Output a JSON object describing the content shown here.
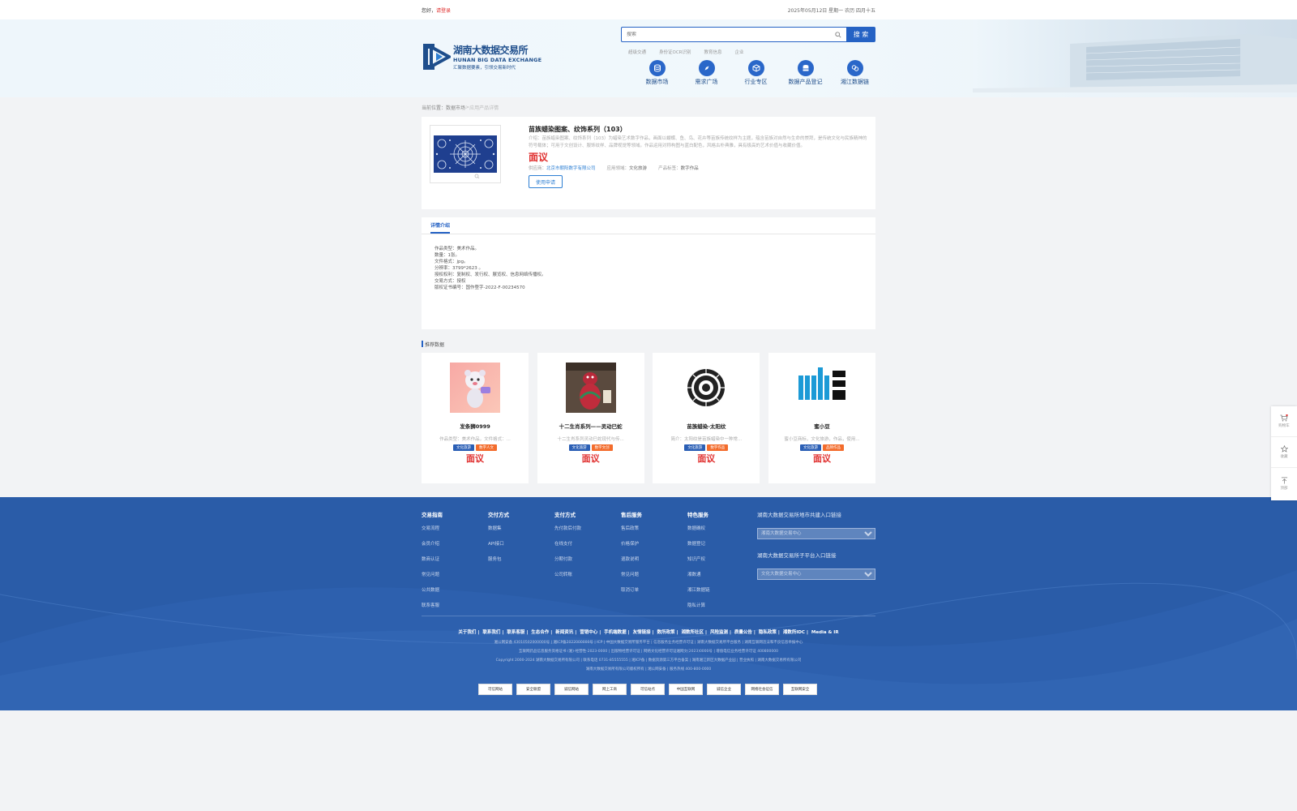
{
  "topbar": {
    "greeting": "您好，",
    "login": "请登录",
    "date": "2025年05月12日 星期一 农历 四月十五"
  },
  "header": {
    "logo_cn": "湖南大数据交易所",
    "logo_en": "HUNAN BIG DATA EXCHANGE",
    "logo_slogan": "汇聚数据要素，引领交易新时代",
    "search_placeholder": "搜索",
    "search_button": "搜 索",
    "hot_keywords": [
      "超级交通",
      "身份证OCR识别",
      "教育信息",
      "企业"
    ],
    "nav": [
      {
        "label": "数据市场",
        "icon": "database-icon"
      },
      {
        "label": "需求广场",
        "icon": "compass-icon"
      },
      {
        "label": "行业专区",
        "icon": "cube-icon"
      },
      {
        "label": "数据产品登记",
        "icon": "register-icon"
      },
      {
        "label": "湘江数据链",
        "icon": "chain-icon"
      }
    ]
  },
  "breadcrumb": {
    "prefix": "当前位置：",
    "level1": "数据市场",
    "sep": " > ",
    "current": "应用产品详情"
  },
  "product": {
    "title": "苗族蜡染图案、纹饰系列（103）",
    "desc_label": "介绍：",
    "description": "苗族蜡染图案、纹饰系列（103）为蜡染艺术数字作品，画面以蝴蝶、鱼、鸟、花卉等苗族传统纹样为主题，蕴含苗族对自然与生命的崇拜，是传统文化与民族精神的符号载体；可用于文创设计、服饰纹样、品牌视觉等领域。作品运用对称构图与蓝白配色，风格古朴典雅，具有极高的艺术价值与收藏价值。",
    "price": "面议",
    "supplier_label": "供应商：",
    "supplier": "北京市朝阳数字有限公司",
    "field_label": "应用领域：",
    "field": "文化旅游",
    "tag_label": "产品标签：",
    "tag": "数字作品",
    "apply_button": "使用申请"
  },
  "detail": {
    "tab": "详情介绍",
    "lines": [
      "作品类型：美术作品。",
      "数量：1张。",
      "文件格式：jpg。",
      "分辨率：3799*2623 。",
      "授权权利：复制权、发行权、展览权、信息网络传播权。",
      "交易方式：授权",
      "版权证书编号：国作登字-2022-F-00234570"
    ]
  },
  "recommend": {
    "title": "推荐数据",
    "cards": [
      {
        "name": "发条狮0999",
        "desc": "作品类型：美术作品，文件格式：...",
        "tag1": "文化旅游",
        "tag2": "数字人文",
        "price": "面议"
      },
      {
        "name": "十二生肖系列——灵动巳蛇",
        "desc": "十二生肖系列灵动巳蛇现代与传...",
        "tag1": "文化旅游",
        "tag2": "数字文创",
        "price": "面议"
      },
      {
        "name": "苗族蜡染-太阳纹",
        "desc": "简介：太阳纹是苗族蜡染中一种常...",
        "tag1": "文化旅游",
        "tag2": "数字作品",
        "price": "面议"
      },
      {
        "name": "蜜小豆",
        "desc": "蜜小豆商标，文化旅游，作品，使用...",
        "tag1": "文化旅游",
        "tag2": "品牌作品",
        "price": "面议"
      }
    ]
  },
  "footer": {
    "columns": [
      {
        "title": "交易指南",
        "items": [
          "交易流程",
          "会员介绍",
          "数商认证",
          "常见问题",
          "公共数据",
          "联系客服"
        ]
      },
      {
        "title": "交付方式",
        "items": [
          "数据集",
          "API接口",
          "服务包"
        ]
      },
      {
        "title": "支付方式",
        "items": [
          "先付款后付款",
          "在线支付",
          "分期付款",
          "公司转账"
        ]
      },
      {
        "title": "售后服务",
        "items": [
          "售后政策",
          "价格保护",
          "退款说明",
          "常见问题",
          "取消订单"
        ]
      },
      {
        "title": "特色服务",
        "items": [
          "数据确权",
          "数据登记",
          "知识产权",
          "湘数通",
          "湘江数据链",
          "隐私计算"
        ]
      }
    ],
    "portal1_title": "湖南大数据交易所地市共建入口链接",
    "portal1_select": "湘南大数据交易中心",
    "portal2_title": "湖南大数据交易所子平台入口链接",
    "portal2_select": "文化大数据交易中心",
    "links": [
      "关于我们",
      "联系我们",
      "联系客服",
      "生态合作",
      "新闻资讯",
      "营销中心",
      "手机端数据",
      "友情链接",
      "数所政策",
      "湘数所社区",
      "风险监测",
      "质量公告",
      "隐私政策",
      "湘数所IDC",
      "Media & IR"
    ],
    "line1": "湘公网安备 43010502000000号  |  湘ICP备2022000000号  |  ICP  |  中国大数据交易所服务平台  |  信息服务业务经营许可证  |  湖南大数据交易所平台服务  |  湖南互联网违法和不良信息举报中心",
    "line2": "互联网药品信息服务资格证书 (湘)-经营性-2023-0000  |  出版物经营许可证  |  网络文化经营许可证湘网文(2023)0000号  |  增值电信业务经营许可证 400800000",
    "line3": "Copyright 2000-2024 湖南大数据交易所有限公司  |  联系电话 0731-85555555  |  湘ICP备  |  数据资源第三方平台备案  |  湖南湘江新区大数据产业园  |  营业执照  |  湖南大数据交易所有限公司",
    "line4": "湖南大数据交易所有限公司版权所有  |  湘公网安备  |  服务热线 400-800-0000",
    "badges": [
      "可信网站",
      "安全联盟",
      "诚信网站",
      "网上工商",
      "可信站点",
      "中国互联网",
      "诚信企业",
      "网络社会征信",
      "互联网安全"
    ]
  },
  "float": {
    "cart": "购物车",
    "cart_count": "0",
    "favorite": "收藏",
    "top": "顶部"
  },
  "colors": {
    "primary": "#2562c4",
    "price_red": "#e0302f",
    "footer_bg": "#2a5ca8",
    "tag_blue": "#2b5fb5",
    "tag_orange": "#f36c2c"
  }
}
